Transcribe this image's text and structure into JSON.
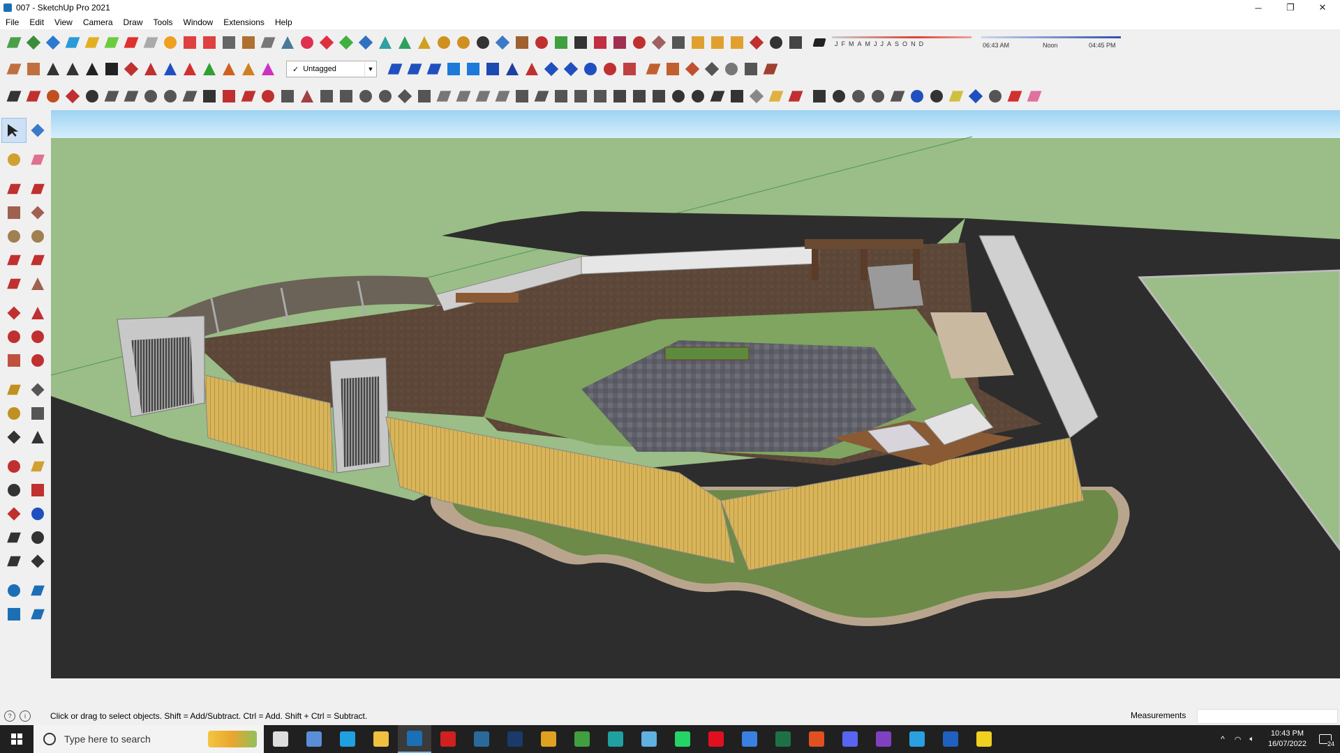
{
  "window": {
    "title": "007 - SketchUp Pro 2021",
    "minimize_icon": "─",
    "restore_icon": "❐",
    "close_icon": "✕"
  },
  "menu": [
    "File",
    "Edit",
    "View",
    "Camera",
    "Draw",
    "Tools",
    "Window",
    "Extensions",
    "Help"
  ],
  "toolbar": {
    "tag_check": "✓",
    "tag_selected": "Untagged",
    "months": [
      "J",
      "F",
      "M",
      "A",
      "M",
      "J",
      "J",
      "A",
      "S",
      "O",
      "N",
      "D"
    ],
    "time_start": "06:43 AM",
    "time_mid": "Noon",
    "time_end": "04:45 PM"
  },
  "status": {
    "hint": "Click or drag to select objects. Shift = Add/Subtract. Ctrl = Add. Shift + Ctrl = Subtract.",
    "measurements_label": "Measurements",
    "measurements_value": ""
  },
  "taskbar": {
    "search_placeholder": "Type here to search",
    "time": "10:43 PM",
    "date": "16/07/2022",
    "notification_count": "24"
  },
  "colors": {
    "sky_top": "#d4ebf9",
    "ground_green": "#9bbd87",
    "asphalt": "#2b2b2b",
    "accent": "#1b6fb5"
  }
}
